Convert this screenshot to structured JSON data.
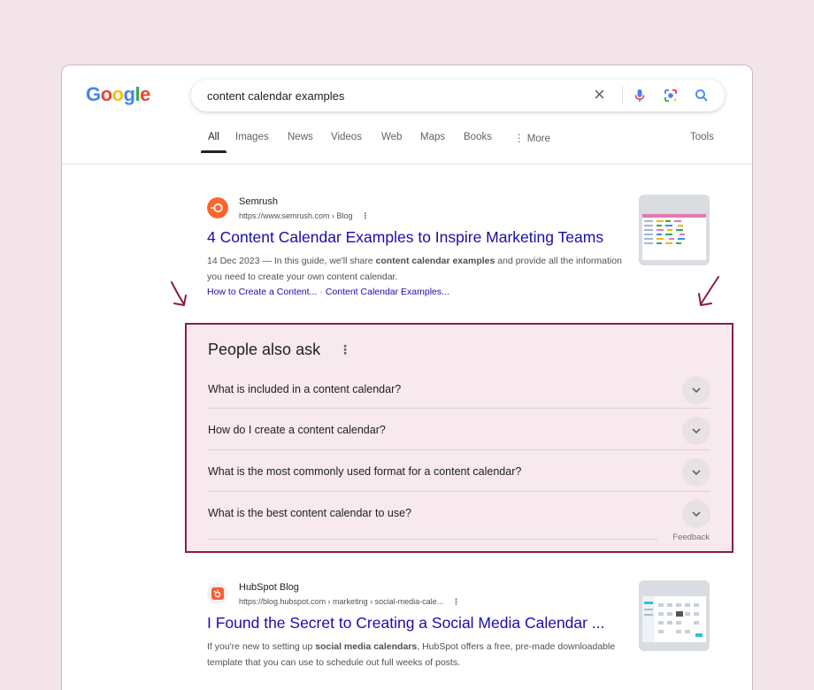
{
  "logo": {
    "letters": [
      "G",
      "o",
      "o",
      "g",
      "l",
      "e"
    ],
    "colors": [
      "#4285F4",
      "#EA4335",
      "#FBBC05",
      "#4285F4",
      "#34A853",
      "#EA4335"
    ]
  },
  "search": {
    "query": "content calendar examples",
    "clear_icon": "close-icon",
    "mic_icon": "mic-icon",
    "lens_icon": "lens-icon",
    "search_icon": "search-icon"
  },
  "tabs": [
    {
      "label": "All",
      "active": true
    },
    {
      "label": "Images"
    },
    {
      "label": "News"
    },
    {
      "label": "Videos"
    },
    {
      "label": "Web"
    },
    {
      "label": "Maps"
    },
    {
      "label": "Books"
    },
    {
      "label": "⋮ More"
    }
  ],
  "tools_label": "Tools",
  "results": [
    {
      "site": "Semrush",
      "url": "https://www.semrush.com › Blog",
      "url_menu": "⋮",
      "title": "4 Content Calendar Examples to Inspire Marketing Teams",
      "snippet_date": "14 Dec 2023 — In this guide, we'll share ",
      "snippet_bold": "content calendar examples",
      "snippet_rest": " and provide all the information you need to create your own content calendar.",
      "sitelinks": [
        "How to Create a Content...",
        "Content Calendar Examples..."
      ],
      "sitelink_sep": "·",
      "favicon_color": "#ff642d"
    },
    {
      "site": "HubSpot Blog",
      "url": "https://blog.hubspot.com › marketing › social-media-cale...",
      "url_menu": "⋮",
      "title": "I Found the Secret to Creating a Social Media Calendar ...",
      "snippet_date": "If you're new to setting up ",
      "snippet_bold": "social media calendars",
      "snippet_rest": ", HubSpot offers a free, pre-made downloadable template that you can use to schedule out full weeks of posts.",
      "favicon_color": "#ff5c35"
    }
  ],
  "paa": {
    "title": "People also ask",
    "menu": "⋮",
    "questions": [
      "What is included in a content calendar?",
      "How do I create a content calendar?",
      "What is the most commonly used format for a content calendar?",
      "What is the best content calendar to use?"
    ],
    "feedback": "Feedback",
    "highlight_color": "#8b1c47"
  }
}
